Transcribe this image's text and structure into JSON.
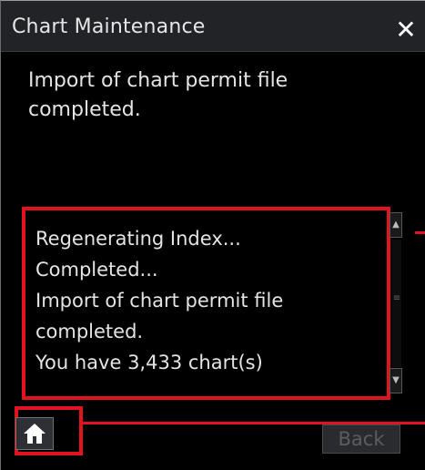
{
  "window": {
    "title": "Chart Maintenance",
    "close_glyph": "✕"
  },
  "message": {
    "line1": "Import of chart permit file",
    "line2": "completed."
  },
  "log": {
    "lines": [
      "Regenerating Index...",
      "Completed...",
      "Import of chart permit file",
      "completed.",
      "You have 3,433 chart(s)"
    ]
  },
  "buttons": {
    "back_label": "Back",
    "home_icon": "home-icon"
  },
  "scrollbar": {
    "up_glyph": "▲",
    "down_glyph": "▼",
    "grip_glyph": "≡"
  },
  "colors": {
    "highlight": "#e0141e",
    "background": "#000000",
    "titlebar": "#222326"
  }
}
